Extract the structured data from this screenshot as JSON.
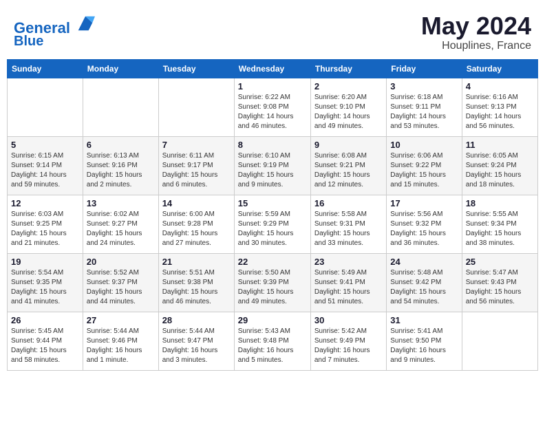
{
  "header": {
    "logo_line1": "General",
    "logo_line2": "Blue",
    "month": "May 2024",
    "location": "Houplines, France"
  },
  "weekdays": [
    "Sunday",
    "Monday",
    "Tuesday",
    "Wednesday",
    "Thursday",
    "Friday",
    "Saturday"
  ],
  "weeks": [
    [
      {
        "day": "",
        "info": ""
      },
      {
        "day": "",
        "info": ""
      },
      {
        "day": "",
        "info": ""
      },
      {
        "day": "1",
        "info": "Sunrise: 6:22 AM\nSunset: 9:08 PM\nDaylight: 14 hours\nand 46 minutes."
      },
      {
        "day": "2",
        "info": "Sunrise: 6:20 AM\nSunset: 9:10 PM\nDaylight: 14 hours\nand 49 minutes."
      },
      {
        "day": "3",
        "info": "Sunrise: 6:18 AM\nSunset: 9:11 PM\nDaylight: 14 hours\nand 53 minutes."
      },
      {
        "day": "4",
        "info": "Sunrise: 6:16 AM\nSunset: 9:13 PM\nDaylight: 14 hours\nand 56 minutes."
      }
    ],
    [
      {
        "day": "5",
        "info": "Sunrise: 6:15 AM\nSunset: 9:14 PM\nDaylight: 14 hours\nand 59 minutes."
      },
      {
        "day": "6",
        "info": "Sunrise: 6:13 AM\nSunset: 9:16 PM\nDaylight: 15 hours\nand 2 minutes."
      },
      {
        "day": "7",
        "info": "Sunrise: 6:11 AM\nSunset: 9:17 PM\nDaylight: 15 hours\nand 6 minutes."
      },
      {
        "day": "8",
        "info": "Sunrise: 6:10 AM\nSunset: 9:19 PM\nDaylight: 15 hours\nand 9 minutes."
      },
      {
        "day": "9",
        "info": "Sunrise: 6:08 AM\nSunset: 9:21 PM\nDaylight: 15 hours\nand 12 minutes."
      },
      {
        "day": "10",
        "info": "Sunrise: 6:06 AM\nSunset: 9:22 PM\nDaylight: 15 hours\nand 15 minutes."
      },
      {
        "day": "11",
        "info": "Sunrise: 6:05 AM\nSunset: 9:24 PM\nDaylight: 15 hours\nand 18 minutes."
      }
    ],
    [
      {
        "day": "12",
        "info": "Sunrise: 6:03 AM\nSunset: 9:25 PM\nDaylight: 15 hours\nand 21 minutes."
      },
      {
        "day": "13",
        "info": "Sunrise: 6:02 AM\nSunset: 9:27 PM\nDaylight: 15 hours\nand 24 minutes."
      },
      {
        "day": "14",
        "info": "Sunrise: 6:00 AM\nSunset: 9:28 PM\nDaylight: 15 hours\nand 27 minutes."
      },
      {
        "day": "15",
        "info": "Sunrise: 5:59 AM\nSunset: 9:29 PM\nDaylight: 15 hours\nand 30 minutes."
      },
      {
        "day": "16",
        "info": "Sunrise: 5:58 AM\nSunset: 9:31 PM\nDaylight: 15 hours\nand 33 minutes."
      },
      {
        "day": "17",
        "info": "Sunrise: 5:56 AM\nSunset: 9:32 PM\nDaylight: 15 hours\nand 36 minutes."
      },
      {
        "day": "18",
        "info": "Sunrise: 5:55 AM\nSunset: 9:34 PM\nDaylight: 15 hours\nand 38 minutes."
      }
    ],
    [
      {
        "day": "19",
        "info": "Sunrise: 5:54 AM\nSunset: 9:35 PM\nDaylight: 15 hours\nand 41 minutes."
      },
      {
        "day": "20",
        "info": "Sunrise: 5:52 AM\nSunset: 9:37 PM\nDaylight: 15 hours\nand 44 minutes."
      },
      {
        "day": "21",
        "info": "Sunrise: 5:51 AM\nSunset: 9:38 PM\nDaylight: 15 hours\nand 46 minutes."
      },
      {
        "day": "22",
        "info": "Sunrise: 5:50 AM\nSunset: 9:39 PM\nDaylight: 15 hours\nand 49 minutes."
      },
      {
        "day": "23",
        "info": "Sunrise: 5:49 AM\nSunset: 9:41 PM\nDaylight: 15 hours\nand 51 minutes."
      },
      {
        "day": "24",
        "info": "Sunrise: 5:48 AM\nSunset: 9:42 PM\nDaylight: 15 hours\nand 54 minutes."
      },
      {
        "day": "25",
        "info": "Sunrise: 5:47 AM\nSunset: 9:43 PM\nDaylight: 15 hours\nand 56 minutes."
      }
    ],
    [
      {
        "day": "26",
        "info": "Sunrise: 5:45 AM\nSunset: 9:44 PM\nDaylight: 15 hours\nand 58 minutes."
      },
      {
        "day": "27",
        "info": "Sunrise: 5:44 AM\nSunset: 9:46 PM\nDaylight: 16 hours\nand 1 minute."
      },
      {
        "day": "28",
        "info": "Sunrise: 5:44 AM\nSunset: 9:47 PM\nDaylight: 16 hours\nand 3 minutes."
      },
      {
        "day": "29",
        "info": "Sunrise: 5:43 AM\nSunset: 9:48 PM\nDaylight: 16 hours\nand 5 minutes."
      },
      {
        "day": "30",
        "info": "Sunrise: 5:42 AM\nSunset: 9:49 PM\nDaylight: 16 hours\nand 7 minutes."
      },
      {
        "day": "31",
        "info": "Sunrise: 5:41 AM\nSunset: 9:50 PM\nDaylight: 16 hours\nand 9 minutes."
      },
      {
        "day": "",
        "info": ""
      }
    ]
  ]
}
